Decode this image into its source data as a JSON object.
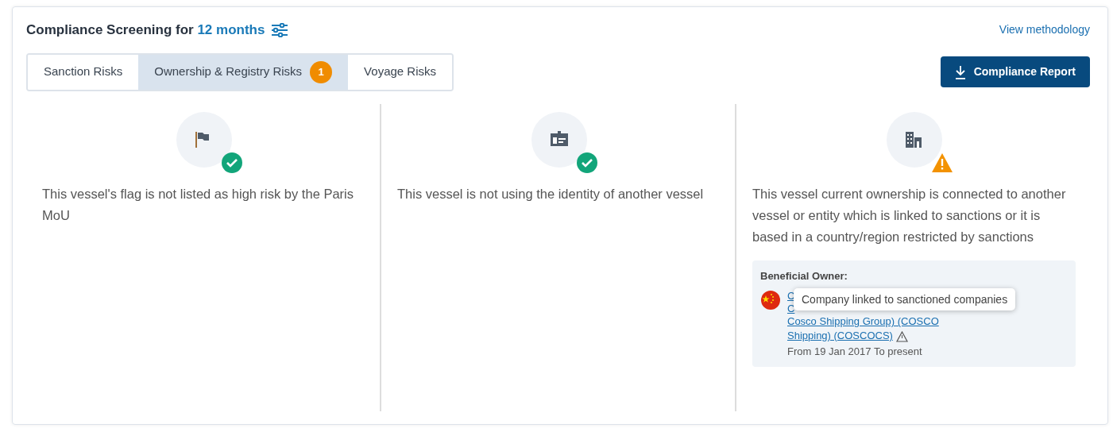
{
  "header": {
    "title": "Compliance Screening for",
    "period": "12 months",
    "link": "View methodology"
  },
  "tabs": [
    {
      "label": "Sanction Risks",
      "selected": false
    },
    {
      "label": "Ownership & Registry Risks",
      "selected": true,
      "badge": "1"
    },
    {
      "label": "Voyage Risks",
      "selected": false
    }
  ],
  "report_button": "Compliance Report",
  "risks": [
    {
      "kind": "flag",
      "flagged": false,
      "text": "This vessel's flag is not listed as high risk by the Paris MoU"
    },
    {
      "kind": "identity",
      "flagged": false,
      "text": "This vessel is not using the identity of another vessel"
    },
    {
      "kind": "ownership",
      "flagged": true,
      "text": "This vessel current ownership is connected to another vessel or entity which is linked to sanctions or it is based in a country/region restricted by sanctions",
      "owner": {
        "label": "Beneficial Owner:",
        "name_lines": [
          "C",
          "C",
          "Cosco Shipping Group) (COSCO",
          "Shipping) (COSCOCS)"
        ],
        "period": "From 19 Jan 2017 To present",
        "tooltip": "Company linked to sanctioned companies"
      }
    }
  ]
}
